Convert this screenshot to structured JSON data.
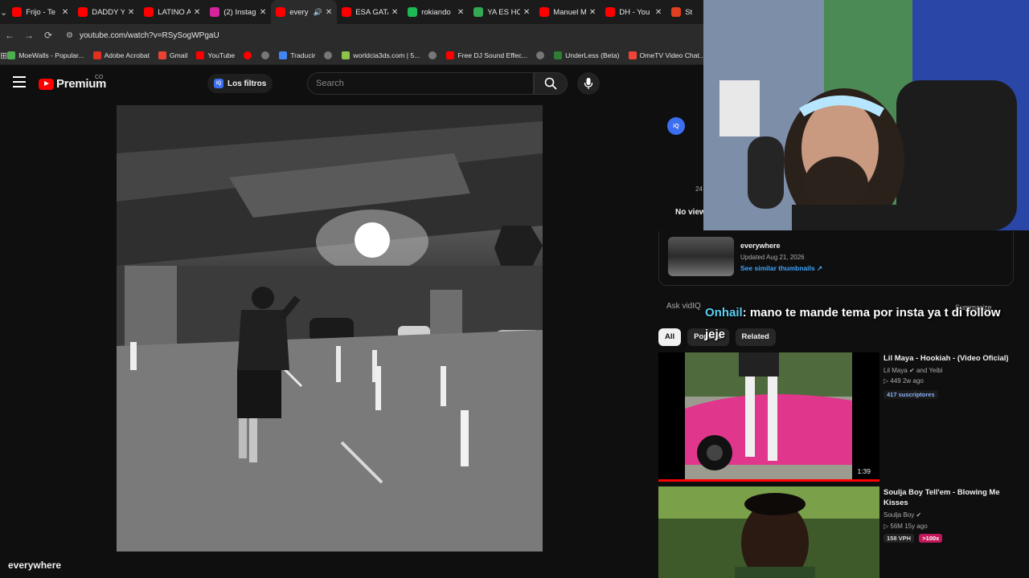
{
  "browser": {
    "tabs": [
      {
        "title": "Frijo - Te",
        "color": "#ff0000",
        "active": false
      },
      {
        "title": "DADDY Y",
        "color": "#ff0000",
        "active": false
      },
      {
        "title": "LATINO A",
        "color": "#ff0000",
        "active": false
      },
      {
        "title": "(2) Instag",
        "color": "#d6249f",
        "active": false
      },
      {
        "title": "every",
        "color": "#ff0000",
        "active": true
      },
      {
        "title": "ESA GATA",
        "color": "#ff0000",
        "active": false
      },
      {
        "title": "rokiando",
        "color": "#1db954",
        "active": false
      },
      {
        "title": "YA ES HO",
        "color": "#34a853",
        "active": false
      },
      {
        "title": "Manuel M",
        "color": "#ff0000",
        "active": false
      },
      {
        "title": "DH - You",
        "color": "#ff0000",
        "active": false
      },
      {
        "title": "St",
        "color": "#e0401f",
        "active": false
      }
    ],
    "url": "youtube.com/watch?v=RSySogWPgaU",
    "bookmarks": [
      {
        "label": "MoeWalls - Popular...",
        "color": "#4caf50"
      },
      {
        "label": "Adobe Acrobat",
        "color": "#e0301e"
      },
      {
        "label": "Gmail",
        "color": "#ea4335"
      },
      {
        "label": "YouTube",
        "color": "#ff0000"
      },
      {
        "label": "",
        "color": "#ff0000"
      },
      {
        "label": "",
        "color": "#777777"
      },
      {
        "label": "Traducir",
        "color": "#4285f4"
      },
      {
        "label": "",
        "color": "#777777"
      },
      {
        "label": "worldcia3ds.com | 5...",
        "color": "#8bc34a"
      },
      {
        "label": "",
        "color": "#777777"
      },
      {
        "label": "Free DJ Sound Effec...",
        "color": "#ff0000"
      },
      {
        "label": "",
        "color": "#777777"
      },
      {
        "label": "UnderLess (Beta)",
        "color": "#2e7d32"
      },
      {
        "label": "OmeTV Video Chat...",
        "color": "#f44336"
      }
    ]
  },
  "youtube": {
    "logo_word": "Premium",
    "logo_country": "CO",
    "filters_label": "Los filtros",
    "search_placeholder": "Search",
    "video_title": "everywhere"
  },
  "sidepanel": {
    "iq_label": "iQ",
    "no_views": "No view",
    "partial_number": "24",
    "thumb_card": {
      "title": "everywhere",
      "updated": "Updated Aug 21, 2026",
      "link": "See similar thumbnails ↗"
    },
    "ask_label": "Ask vidIQ",
    "summarize_label": "Summarize",
    "chips": [
      "All",
      "Popular",
      "Related"
    ]
  },
  "recommendations": [
    {
      "title": "Lil Maya - Hookiah - (Video Oficial)",
      "channel": "Lil Maya",
      "collab": "and Yeibi",
      "views": "449",
      "age": "2w ago",
      "badge": "417 suscriptores",
      "duration": "1:39"
    },
    {
      "title": "Soulja Boy Tell'em - Blowing Me Kisses",
      "channel": "Soulja Boy",
      "views": "56M",
      "age": "15y ago",
      "badge1": "158 VPH",
      "badge2": ">100x"
    }
  ],
  "chat": {
    "user": "Onhail",
    "message": ": mano te mande tema por insta ya t di follow jeje"
  }
}
